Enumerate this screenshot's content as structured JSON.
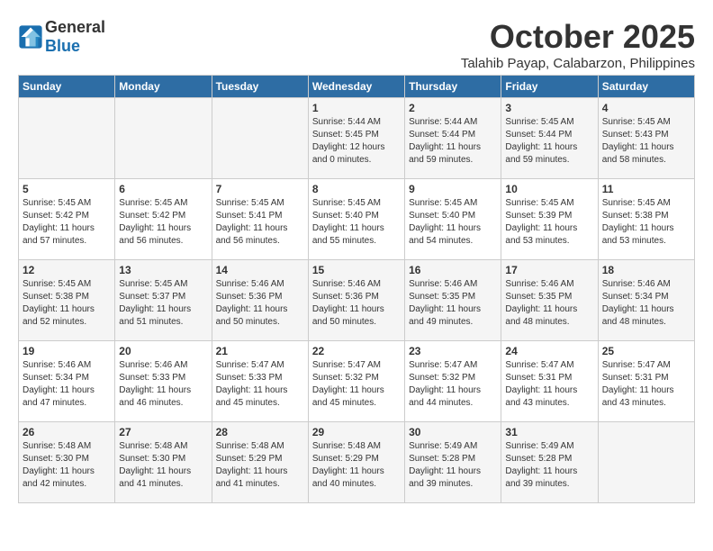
{
  "header": {
    "logo_general": "General",
    "logo_blue": "Blue",
    "month_title": "October 2025",
    "location": "Talahib Payap, Calabarzon, Philippines"
  },
  "calendar": {
    "headers": [
      "Sunday",
      "Monday",
      "Tuesday",
      "Wednesday",
      "Thursday",
      "Friday",
      "Saturday"
    ],
    "weeks": [
      [
        {
          "day": "",
          "info": ""
        },
        {
          "day": "",
          "info": ""
        },
        {
          "day": "",
          "info": ""
        },
        {
          "day": "1",
          "info": "Sunrise: 5:44 AM\nSunset: 5:45 PM\nDaylight: 12 hours\nand 0 minutes."
        },
        {
          "day": "2",
          "info": "Sunrise: 5:44 AM\nSunset: 5:44 PM\nDaylight: 11 hours\nand 59 minutes."
        },
        {
          "day": "3",
          "info": "Sunrise: 5:45 AM\nSunset: 5:44 PM\nDaylight: 11 hours\nand 59 minutes."
        },
        {
          "day": "4",
          "info": "Sunrise: 5:45 AM\nSunset: 5:43 PM\nDaylight: 11 hours\nand 58 minutes."
        }
      ],
      [
        {
          "day": "5",
          "info": "Sunrise: 5:45 AM\nSunset: 5:42 PM\nDaylight: 11 hours\nand 57 minutes."
        },
        {
          "day": "6",
          "info": "Sunrise: 5:45 AM\nSunset: 5:42 PM\nDaylight: 11 hours\nand 56 minutes."
        },
        {
          "day": "7",
          "info": "Sunrise: 5:45 AM\nSunset: 5:41 PM\nDaylight: 11 hours\nand 56 minutes."
        },
        {
          "day": "8",
          "info": "Sunrise: 5:45 AM\nSunset: 5:40 PM\nDaylight: 11 hours\nand 55 minutes."
        },
        {
          "day": "9",
          "info": "Sunrise: 5:45 AM\nSunset: 5:40 PM\nDaylight: 11 hours\nand 54 minutes."
        },
        {
          "day": "10",
          "info": "Sunrise: 5:45 AM\nSunset: 5:39 PM\nDaylight: 11 hours\nand 53 minutes."
        },
        {
          "day": "11",
          "info": "Sunrise: 5:45 AM\nSunset: 5:38 PM\nDaylight: 11 hours\nand 53 minutes."
        }
      ],
      [
        {
          "day": "12",
          "info": "Sunrise: 5:45 AM\nSunset: 5:38 PM\nDaylight: 11 hours\nand 52 minutes."
        },
        {
          "day": "13",
          "info": "Sunrise: 5:45 AM\nSunset: 5:37 PM\nDaylight: 11 hours\nand 51 minutes."
        },
        {
          "day": "14",
          "info": "Sunrise: 5:46 AM\nSunset: 5:36 PM\nDaylight: 11 hours\nand 50 minutes."
        },
        {
          "day": "15",
          "info": "Sunrise: 5:46 AM\nSunset: 5:36 PM\nDaylight: 11 hours\nand 50 minutes."
        },
        {
          "day": "16",
          "info": "Sunrise: 5:46 AM\nSunset: 5:35 PM\nDaylight: 11 hours\nand 49 minutes."
        },
        {
          "day": "17",
          "info": "Sunrise: 5:46 AM\nSunset: 5:35 PM\nDaylight: 11 hours\nand 48 minutes."
        },
        {
          "day": "18",
          "info": "Sunrise: 5:46 AM\nSunset: 5:34 PM\nDaylight: 11 hours\nand 48 minutes."
        }
      ],
      [
        {
          "day": "19",
          "info": "Sunrise: 5:46 AM\nSunset: 5:34 PM\nDaylight: 11 hours\nand 47 minutes."
        },
        {
          "day": "20",
          "info": "Sunrise: 5:46 AM\nSunset: 5:33 PM\nDaylight: 11 hours\nand 46 minutes."
        },
        {
          "day": "21",
          "info": "Sunrise: 5:47 AM\nSunset: 5:33 PM\nDaylight: 11 hours\nand 45 minutes."
        },
        {
          "day": "22",
          "info": "Sunrise: 5:47 AM\nSunset: 5:32 PM\nDaylight: 11 hours\nand 45 minutes."
        },
        {
          "day": "23",
          "info": "Sunrise: 5:47 AM\nSunset: 5:32 PM\nDaylight: 11 hours\nand 44 minutes."
        },
        {
          "day": "24",
          "info": "Sunrise: 5:47 AM\nSunset: 5:31 PM\nDaylight: 11 hours\nand 43 minutes."
        },
        {
          "day": "25",
          "info": "Sunrise: 5:47 AM\nSunset: 5:31 PM\nDaylight: 11 hours\nand 43 minutes."
        }
      ],
      [
        {
          "day": "26",
          "info": "Sunrise: 5:48 AM\nSunset: 5:30 PM\nDaylight: 11 hours\nand 42 minutes."
        },
        {
          "day": "27",
          "info": "Sunrise: 5:48 AM\nSunset: 5:30 PM\nDaylight: 11 hours\nand 41 minutes."
        },
        {
          "day": "28",
          "info": "Sunrise: 5:48 AM\nSunset: 5:29 PM\nDaylight: 11 hours\nand 41 minutes."
        },
        {
          "day": "29",
          "info": "Sunrise: 5:48 AM\nSunset: 5:29 PM\nDaylight: 11 hours\nand 40 minutes."
        },
        {
          "day": "30",
          "info": "Sunrise: 5:49 AM\nSunset: 5:28 PM\nDaylight: 11 hours\nand 39 minutes."
        },
        {
          "day": "31",
          "info": "Sunrise: 5:49 AM\nSunset: 5:28 PM\nDaylight: 11 hours\nand 39 minutes."
        },
        {
          "day": "",
          "info": ""
        }
      ]
    ]
  }
}
